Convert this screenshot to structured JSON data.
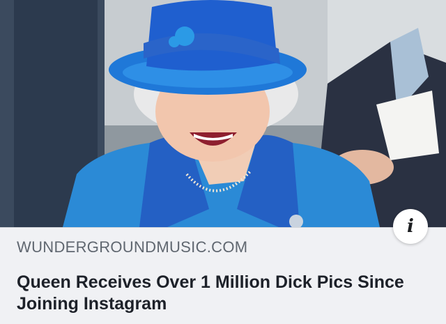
{
  "link_preview": {
    "domain": "WUNDERGROUNDMUSIC.COM",
    "headline": "Queen Receives Over 1 Million Dick Pics Since Joining Instagram",
    "info_glyph": "i",
    "info_icon": "info-icon"
  },
  "colors": {
    "card_background": "#f0f1f4",
    "domain_text": "#606770",
    "headline_text": "#1d2129",
    "hat_blue": "#1f5fcf",
    "coat_blue": "#2b8ad6"
  }
}
